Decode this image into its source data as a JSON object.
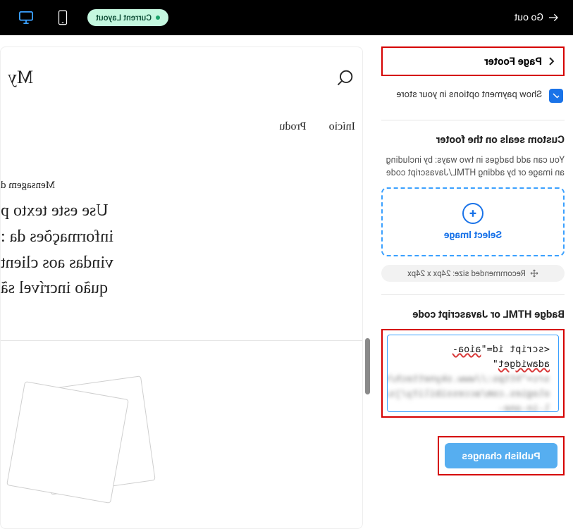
{
  "topbar": {
    "go_out": "Go out",
    "current_layout": "Current Layout"
  },
  "sidebar": {
    "page_footer_label": "Page Footer",
    "show_payment_options": "Show payment options in your store",
    "custom_seals_title": "Custom seals on the footer",
    "custom_seals_desc": "You can add badges in two ways: by including an image or by adding HTML/Javascript code",
    "select_image": "Select Image",
    "recommended_size": "Recommended size: 24px x 24px",
    "badge_code_title": "Badge HTML or Javascript code",
    "code_line1": "<script id=\"aioa-adawidget\"",
    "code_blur_lines": [
      "src=\"https://www.skynettech/n",
      "ologies.com/accessibility/js/al",
      "l-in-one-accessibility.js..."
    ],
    "publish_label": "Publish changes"
  },
  "preview": {
    "title_fragment": "My",
    "nav": {
      "item0": "Início",
      "item1": "Produ"
    },
    "message_label": "Mensagem d",
    "body_lines": {
      "l0": "Use este texto p",
      "l1": "informações da :",
      "l2": "vindas aos client",
      "l3": "quão incrível sã"
    }
  }
}
